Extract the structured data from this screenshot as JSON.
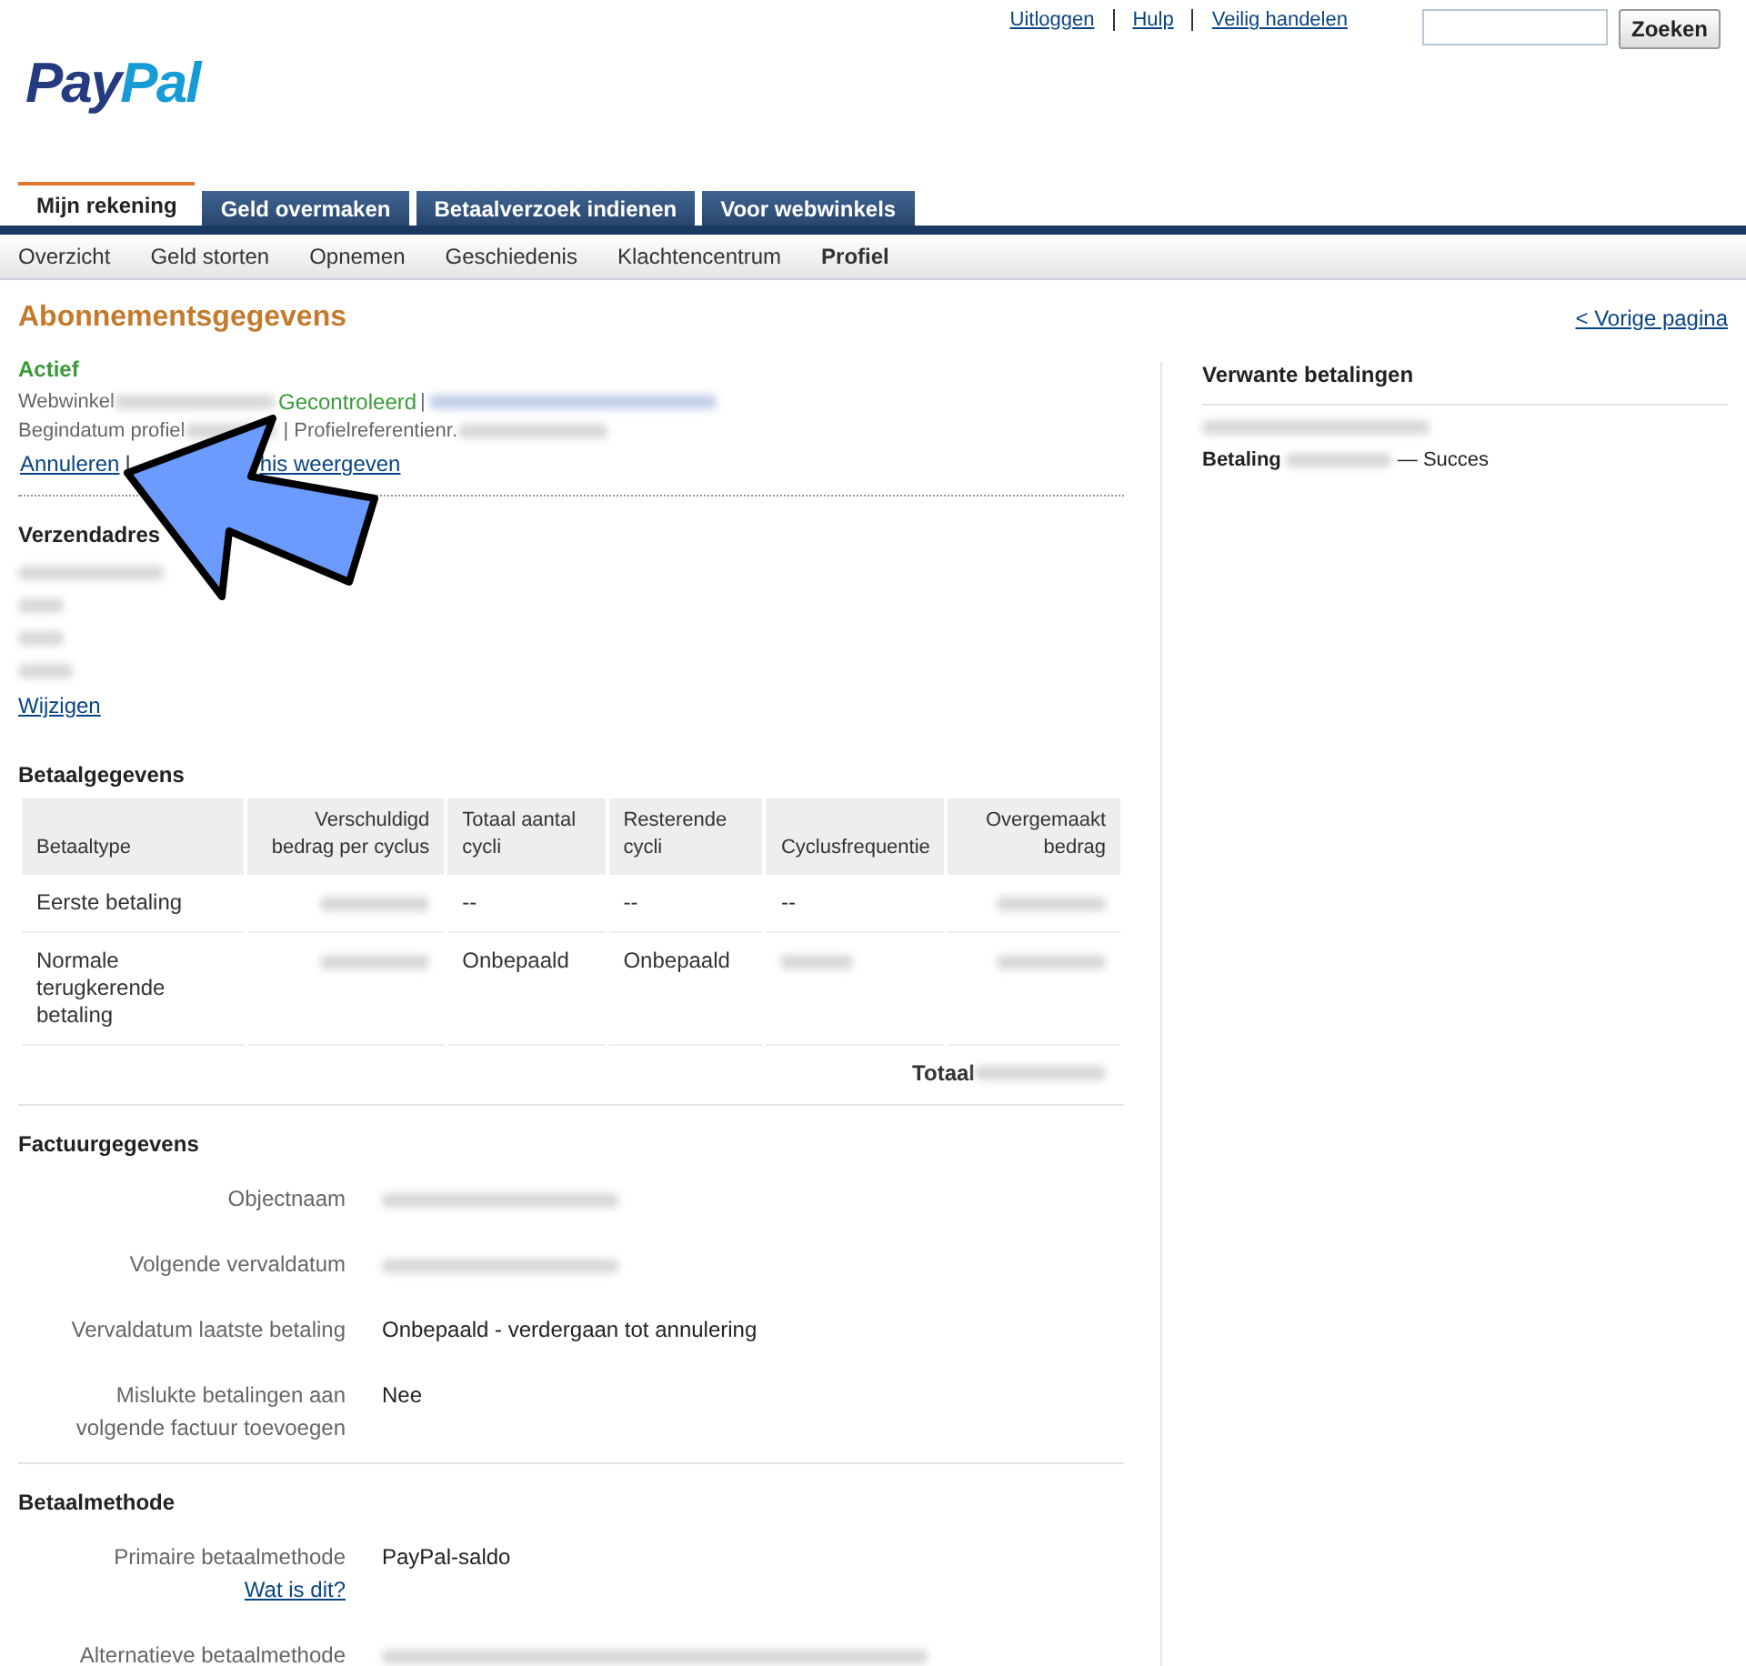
{
  "header_links": [
    {
      "label": "Uitloggen"
    },
    {
      "label": "Hulp"
    },
    {
      "label": "Veilig handelen"
    }
  ],
  "search": {
    "button": "Zoeken"
  },
  "logo": {
    "part_1": "Pay",
    "part_2": "Pal"
  },
  "tabs": [
    {
      "label": "Mijn rekening",
      "selected": true
    },
    {
      "label": "Geld overmaken",
      "selected": false
    },
    {
      "label": "Betaalverzoek indienen",
      "selected": false
    },
    {
      "label": "Voor webwinkels",
      "selected": false
    }
  ],
  "subnav": [
    {
      "label": "Overzicht",
      "selected": false
    },
    {
      "label": "Geld storten",
      "selected": false
    },
    {
      "label": "Opnemen",
      "selected": false
    },
    {
      "label": "Geschiedenis",
      "selected": false
    },
    {
      "label": "Klachtencentrum",
      "selected": false
    },
    {
      "label": "Profiel",
      "selected": true
    }
  ],
  "page_title": "Abonnementsgegevens",
  "back_link": "< Vorige pagina",
  "status": "Actief",
  "merchant": {
    "label": "Webwinkel",
    "verified": "Gecontroleerd",
    "separator": "|"
  },
  "profile_line": {
    "start_label": "Begindatum profiel",
    "ref_label": "| Profielreferentienr."
  },
  "actions": {
    "cancel": "Annuleren",
    "separator": "|",
    "history_end": "his weergeven"
  },
  "shipping": {
    "title": "Verzendadres",
    "edit": "Wijzigen"
  },
  "payment": {
    "title": "Betaalgegevens",
    "columns": [
      "Betaaltype",
      "Verschuldigd bedrag per cyclus",
      "Totaal aantal cycli",
      "Resterende cycli",
      "Cyclusfrequentie",
      "Overgemaakt bedrag"
    ],
    "rows": [
      {
        "cells": [
          {
            "kind": "text",
            "text": "Eerste betaling"
          },
          {
            "kind": "blurred"
          },
          {
            "kind": "text",
            "text": "--"
          },
          {
            "kind": "text",
            "text": "--"
          },
          {
            "kind": "text",
            "text": "--"
          },
          {
            "kind": "blurred"
          }
        ]
      },
      {
        "cells": [
          {
            "kind": "text",
            "text": "Normale terugkerende betaling"
          },
          {
            "kind": "blurred"
          },
          {
            "kind": "text",
            "text": "Onbepaald"
          },
          {
            "kind": "text",
            "text": "Onbepaald"
          },
          {
            "kind": "blurred"
          },
          {
            "kind": "blurred"
          }
        ]
      }
    ],
    "total_label": "Totaal"
  },
  "billing": {
    "title": "Factuurgegevens",
    "rows": [
      {
        "label": "Objectnaam",
        "kind": "blurred"
      },
      {
        "label": "Volgende vervaldatum",
        "kind": "blurred"
      },
      {
        "label": "Vervaldatum laatste betaling",
        "kind": "text",
        "value": "Onbepaald - verdergaan tot annulering"
      },
      {
        "label": "Mislukte betalingen aan volgende factuur toevoegen",
        "kind": "text",
        "value": "Nee"
      }
    ]
  },
  "method": {
    "title": "Betaalmethode",
    "rows": [
      {
        "label": "Primaire betaalmethode",
        "link": "Wat is dit?",
        "kind": "text",
        "value": "PayPal-saldo"
      },
      {
        "label": "Alternatieve betaalmethode",
        "kind": "blurred"
      }
    ]
  },
  "related": {
    "title": "Verwante betalingen",
    "payment_label": "Betaling",
    "status": "— Succes"
  }
}
